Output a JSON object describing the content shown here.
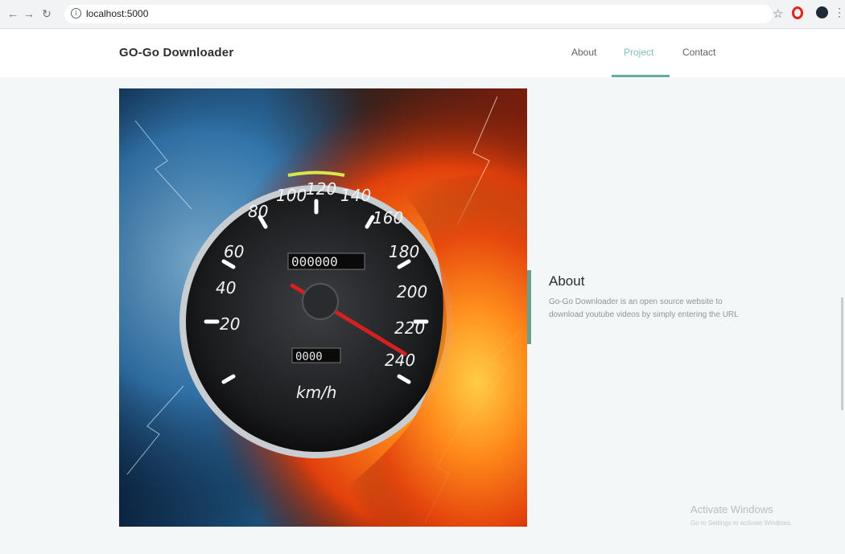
{
  "browser": {
    "url": "localhost:5000",
    "icons": [
      "back-arrow-icon",
      "forward-arrow-icon",
      "reload-icon",
      "site-info-icon",
      "bookmark-star-icon",
      "opera-icon",
      "profile-avatar-icon",
      "kebab-menu-icon"
    ]
  },
  "header": {
    "brand": "GO-Go Downloader",
    "nav": [
      {
        "label": "About"
      },
      {
        "label": "Project",
        "active": true
      },
      {
        "label": "Contact"
      }
    ],
    "active_color": "#6aa99c"
  },
  "about": {
    "heading": "About",
    "text": "Go-Go Downloader is an open source website to download youtube videos by simply entering the URL"
  },
  "hero": {
    "speedometer_labels": [
      "80",
      "100",
      "120",
      "140",
      "160",
      "180",
      "200",
      "220",
      "240",
      "60",
      "40",
      "20"
    ],
    "odometer": "000000",
    "trip": "0000",
    "unit": "km/h"
  },
  "watermark": {
    "title": "Activate Windows",
    "subtitle": "Go to Settings to activate Windows."
  }
}
